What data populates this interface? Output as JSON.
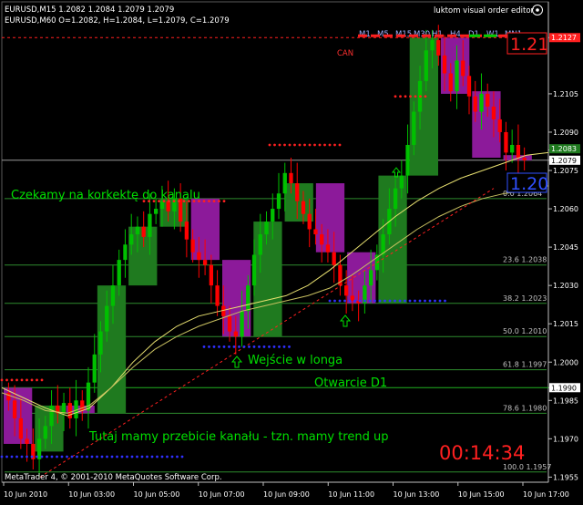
{
  "header": {
    "line1": "EURUSD,M15  1.2082 1.2084 1.2079 1.2079",
    "line2": "EURUSD,M60  O=1.2082, H=1.2084, L=1.2079, C=1.2079",
    "editor_label": "luktom visual order editor",
    "timeframes": [
      "M1",
      "M5",
      "M15",
      "M30",
      "H1",
      "H4",
      "D1",
      "W1",
      "MN1"
    ],
    "can_label": "CAN"
  },
  "footer": {
    "copyright": "MetaTrader 4, © 2001-2010 MetaQuotes Software Corp."
  },
  "colors": {
    "background": "#000000",
    "bull_candle": "#00c000",
    "bear_candle": "#ff0000",
    "h1_bull_box": "#1f7a1f",
    "h1_bear_box": "#8c1a9a",
    "ma": "#e8e070",
    "fib": "#2e8b2e",
    "dots_red": "#ff2020",
    "dots_blue": "#3030ff",
    "annotation": "#00e000",
    "timer": "#ff2020"
  },
  "annotations": {
    "a1": "Czekamy na korkektę do kanalu",
    "a2": "Wejście w longa",
    "a3": "Otwarcie D1",
    "a4": "Tutaj mamy przebicie kanału - tzn. mamy trend up",
    "timer": "00:14:34",
    "big_label_top": "1.21",
    "big_label_mid": "1.20"
  },
  "chart_data": {
    "type": "candlestick",
    "symbol": "EURUSD",
    "timeframe": "M15",
    "y_ticks": [
      "1.2127",
      "1.2105",
      "1.2090",
      "1.2083",
      "1.2079",
      "1.2075",
      "1.2060",
      "1.2045",
      "1.2030",
      "1.2015",
      "1.2000",
      "1.1990",
      "1.1985",
      "1.1970",
      "1.1955"
    ],
    "ylim": [
      1.1953,
      1.2141
    ],
    "x_ticks": [
      "10 Jun 2010",
      "10 Jun 03:00",
      "10 Jun 05:00",
      "10 Jun 07:00",
      "10 Jun 09:00",
      "10 Jun 11:00",
      "10 Jun 13:00",
      "10 Jun 15:00",
      "10 Jun 17:00"
    ],
    "price_markers": [
      {
        "label": "1.2127",
        "value": 1.2127,
        "bg": "#ff2020"
      },
      {
        "label": "1.2083",
        "value": 1.20835,
        "bg": "#1f7a1f"
      },
      {
        "label": "1.2079",
        "value": 1.2079,
        "bg": "#ffffff"
      },
      {
        "label": "1.1990",
        "value": 1.199,
        "bg": "#ffffff"
      }
    ],
    "fib_levels": [
      {
        "label": "0.0  1.2064",
        "value": 1.2064
      },
      {
        "label": "23.6  1.2038",
        "value": 1.2038
      },
      {
        "label": "38.2  1.2023",
        "value": 1.2023
      },
      {
        "label": "50.0  1.2010",
        "value": 1.201
      },
      {
        "label": "61.8  1.1997",
        "value": 1.1997
      },
      {
        "label": "78.6  1.1980",
        "value": 1.198
      },
      {
        "label": "100.0  1.1957",
        "value": 1.1957
      }
    ],
    "h1_boxes": [
      {
        "o": 1.199,
        "c": 1.1968,
        "h": 1.1992,
        "l": 1.196
      },
      {
        "o": 1.1965,
        "c": 1.1983,
        "h": 1.1985,
        "l": 1.1958
      },
      {
        "o": 1.1983,
        "c": 1.198,
        "h": 1.1988,
        "l": 1.1975
      },
      {
        "o": 1.198,
        "c": 1.203,
        "h": 1.2035,
        "l": 1.1978
      },
      {
        "o": 1.203,
        "c": 1.2053,
        "h": 1.2058,
        "l": 1.2025
      },
      {
        "o": 1.2053,
        "c": 1.2064,
        "h": 1.2066,
        "l": 1.2045
      },
      {
        "o": 1.2064,
        "c": 1.204,
        "h": 1.2066,
        "l": 1.2035
      },
      {
        "o": 1.204,
        "c": 1.201,
        "h": 1.2045,
        "l": 1.2005
      },
      {
        "o": 1.201,
        "c": 1.2055,
        "h": 1.2058,
        "l": 1.2005
      },
      {
        "o": 1.2055,
        "c": 1.207,
        "h": 1.2086,
        "l": 1.2052
      },
      {
        "o": 1.207,
        "c": 1.2043,
        "h": 1.208,
        "l": 1.204
      },
      {
        "o": 1.2043,
        "c": 1.2023,
        "h": 1.2048,
        "l": 1.2018
      },
      {
        "o": 1.2023,
        "c": 1.2073,
        "h": 1.2075,
        "l": 1.202
      },
      {
        "o": 1.2073,
        "c": 1.2127,
        "h": 1.2129,
        "l": 1.2062
      },
      {
        "o": 1.2127,
        "c": 1.2105,
        "h": 1.2129,
        "l": 1.2098
      },
      {
        "o": 1.2106,
        "c": 1.208,
        "h": 1.2108,
        "l": 1.2076
      },
      {
        "o": 1.2081,
        "c": 1.2079,
        "h": 1.2084,
        "l": 1.2077
      }
    ],
    "m15_closes": [
      1.1985,
      1.1978,
      1.197,
      1.1968,
      1.1962,
      1.197,
      1.1975,
      1.1983,
      1.198,
      1.1984,
      1.1978,
      1.1985,
      1.1981,
      1.1992,
      1.2003,
      1.2012,
      1.2022,
      1.203,
      1.204,
      1.2046,
      1.205,
      1.2053,
      1.2049,
      1.2058,
      1.206,
      1.2063,
      1.2059,
      1.2064,
      1.2055,
      1.2048,
      1.2043,
      1.204,
      1.2038,
      1.203,
      1.2022,
      1.2018,
      1.2012,
      1.201,
      1.202,
      1.203,
      1.2042,
      1.205,
      1.2055,
      1.206,
      1.2066,
      1.2074,
      1.207,
      1.2063,
      1.2058,
      1.2052,
      1.205,
      1.2046,
      1.2043,
      1.2038,
      1.203,
      1.2026,
      1.2024,
      1.2023,
      1.203,
      1.2036,
      1.2042,
      1.205,
      1.206,
      1.2068,
      1.2073,
      1.2085,
      1.2098,
      1.211,
      1.2122,
      1.2126,
      1.212,
      1.2113,
      1.2106,
      1.2118,
      1.2112,
      1.2104,
      1.2098,
      1.2105,
      1.21,
      1.2095,
      1.209,
      1.2082,
      1.2085,
      1.208,
      1.2079
    ],
    "ma_fast": [
      1.199,
      1.1986,
      1.1982,
      1.1979,
      1.1982,
      1.199,
      1.2,
      1.2008,
      1.2014,
      1.2018,
      1.202,
      1.2022,
      1.2024,
      1.2026,
      1.203,
      1.2036,
      1.2043,
      1.205,
      1.2057,
      1.2063,
      1.2068,
      1.2072,
      1.2075,
      1.2078,
      1.2081,
      1.2082
    ],
    "ma_slow": [
      1.1988,
      1.1985,
      1.1981,
      1.198,
      1.1983,
      1.199,
      1.1998,
      1.2005,
      1.201,
      1.2014,
      1.2017,
      1.202,
      1.2022,
      1.2024,
      1.2026,
      1.2029,
      1.2034,
      1.204,
      1.2046,
      1.2052,
      1.2057,
      1.2061,
      1.2064,
      1.2066,
      1.2067,
      1.2069
    ],
    "channel_line": {
      "x0": 0.07,
      "y0": 1.1955,
      "x1": 0.9,
      "y1": 1.2068
    }
  }
}
